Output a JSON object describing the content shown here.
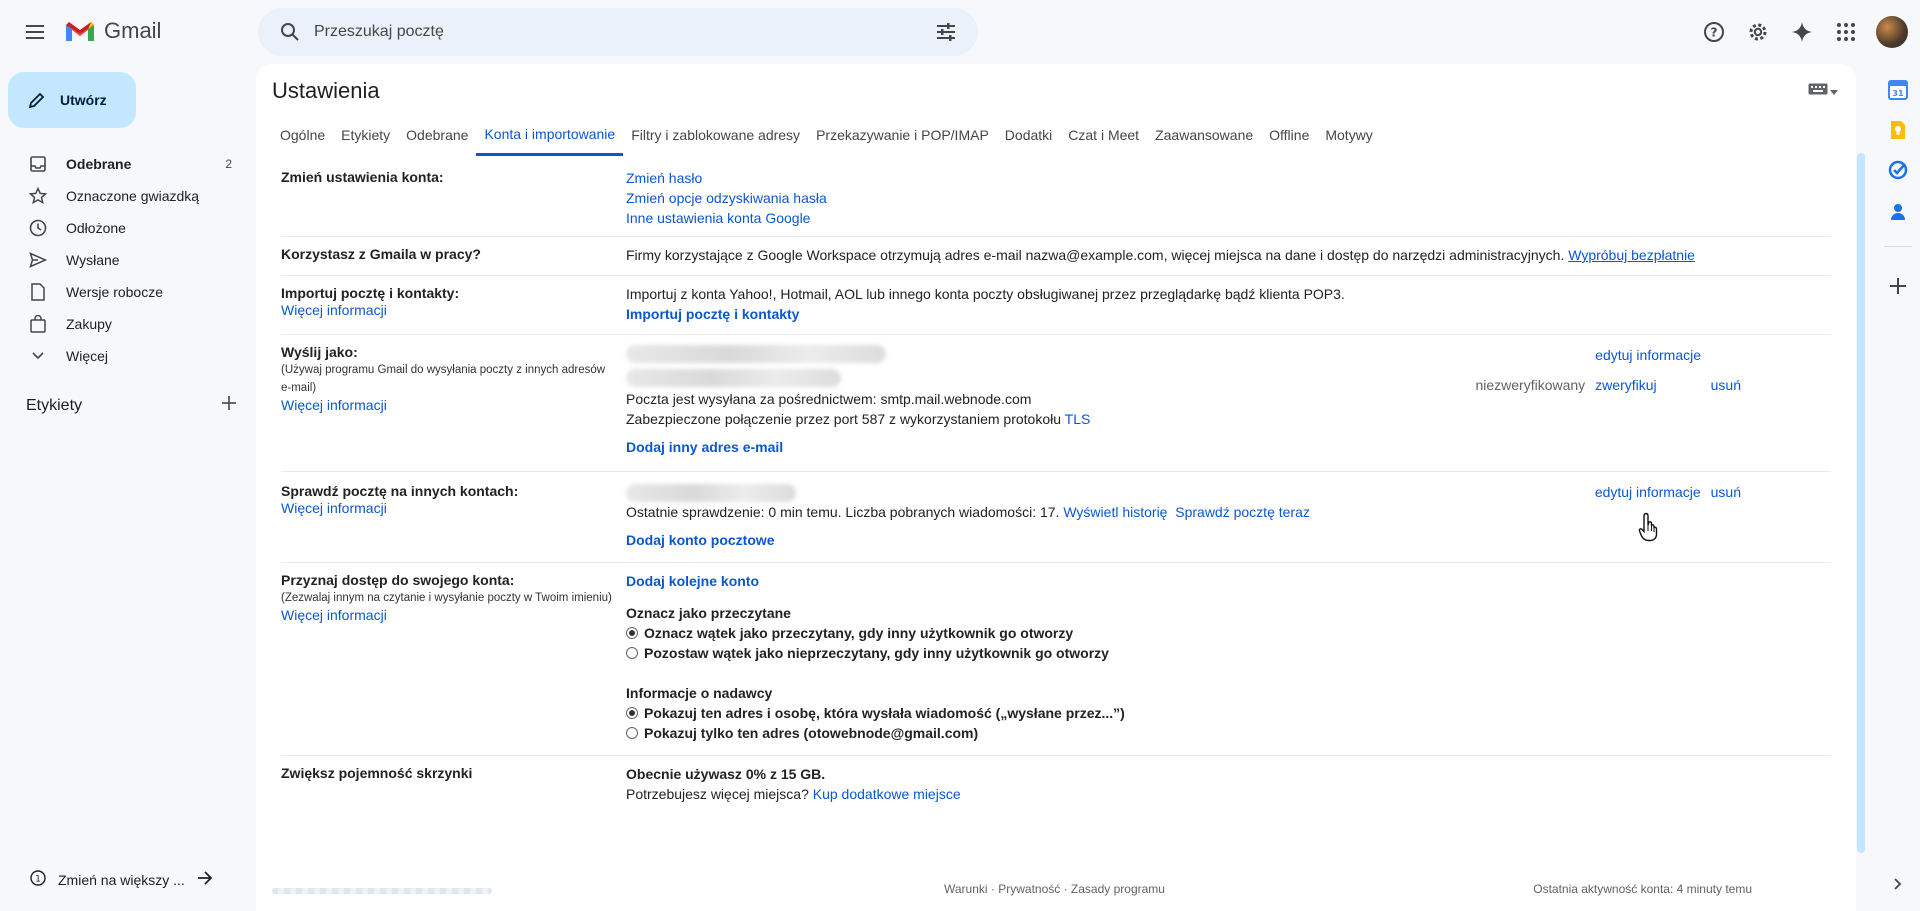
{
  "app": {
    "name": "Gmail"
  },
  "search": {
    "placeholder": "Przeszukaj pocztę"
  },
  "compose": {
    "label": "Utwórz"
  },
  "nav": [
    {
      "label": "Odebrane",
      "count": "2",
      "icon": "inbox-icon",
      "bold": true
    },
    {
      "label": "Oznaczone gwiazdką",
      "count": "",
      "icon": "star-icon",
      "bold": false
    },
    {
      "label": "Odłożone",
      "count": "",
      "icon": "clock-icon",
      "bold": false
    },
    {
      "label": "Wysłane",
      "count": "",
      "icon": "send-icon",
      "bold": false
    },
    {
      "label": "Wersje robocze",
      "count": "",
      "icon": "draft-icon",
      "bold": false
    },
    {
      "label": "Zakupy",
      "count": "",
      "icon": "shopping-bag-icon",
      "bold": false
    },
    {
      "label": "Więcej",
      "count": "",
      "icon": "chevron-down-icon",
      "bold": false
    }
  ],
  "labels_heading": "Etykiety",
  "bottom_left": "Zmień na większy ...",
  "page_title": "Ustawienia",
  "tabs": [
    {
      "label": "Ogólne",
      "active": false
    },
    {
      "label": "Etykiety",
      "active": false
    },
    {
      "label": "Odebrane",
      "active": false
    },
    {
      "label": "Konta i importowanie",
      "active": true
    },
    {
      "label": "Filtry i zablokowane adresy",
      "active": false
    },
    {
      "label": "Przekazywanie i POP/IMAP",
      "active": false
    },
    {
      "label": "Dodatki",
      "active": false
    },
    {
      "label": "Czat i Meet",
      "active": false
    },
    {
      "label": "Zaawansowane",
      "active": false
    },
    {
      "label": "Offline",
      "active": false
    },
    {
      "label": "Motywy",
      "active": false
    }
  ],
  "settings": {
    "change_account": {
      "title": "Zmień ustawienia konta:",
      "links": [
        "Zmień hasło",
        "Zmień opcje odzyskiwania hasła",
        "Inne ustawienia konta Google"
      ]
    },
    "work": {
      "title": "Korzystasz z Gmaila w pracy?",
      "text": "Firmy korzystające z Google Workspace otrzymują adres e-mail nazwa@example.com, więcej miejsca na dane i dostęp do narzędzi administracyjnych.",
      "link": "Wypróbuj bezpłatnie"
    },
    "import": {
      "title": "Importuj pocztę i kontakty:",
      "more": "Więcej informacji",
      "text": "Importuj z konta Yahoo!, Hotmail, AOL lub innego konta poczty obsługiwanej przez przeglądarkę bądź klienta POP3.",
      "link": "Importuj pocztę i kontakty"
    },
    "send_as": {
      "title": "Wyślij jako:",
      "sub": "(Używaj programu Gmail do wysyłania poczty z innych adresów e-mail)",
      "more": "Więcej informacji",
      "edit": "edytuj informacje",
      "unverified": "niezweryfikowany",
      "verify": "zweryfikuj",
      "remove": "usuń",
      "smtp": "Poczta jest wysyłana za pośrednictwem: smtp.mail.webnode.com",
      "secure_prefix": "Zabezpieczone połączenie przez port 587 z wykorzystaniem protokołu",
      "tls": "TLS",
      "add": "Dodaj inny adres e-mail"
    },
    "check_mail": {
      "title": "Sprawdź pocztę na innych kontach:",
      "more": "Więcej informacji",
      "edit": "edytuj informacje",
      "remove": "usuń",
      "status": "Ostatnie sprawdzenie: 0 min temu. Liczba pobranych wiadomości: 17.",
      "history": "Wyświetl historię",
      "check_now": "Sprawdź pocztę teraz",
      "add": "Dodaj konto pocztowe"
    },
    "grant": {
      "title": "Przyznaj dostęp do swojego konta:",
      "sub": "(Zezwalaj innym na czytanie i wysyłanie poczty w Twoim imieniu)",
      "more": "Więcej informacji",
      "add": "Dodaj kolejne konto",
      "mark_title": "Oznacz jako przeczytane",
      "mark_opt1": "Oznacz wątek jako przeczytany, gdy inny użytkownik go otworzy",
      "mark_opt2": "Pozostaw wątek jako nieprzeczytany, gdy inny użytkownik go otworzy",
      "sender_title": "Informacje o nadawcy",
      "sender_opt1": "Pokazuj ten adres i osobę, która wysłała wiadomość („wysłane przez...”)",
      "sender_opt2": "Pokazuj tylko ten adres (otowebnode@gmail.com)"
    },
    "storage": {
      "title": "Zwiększ pojemność skrzynki",
      "usage": "Obecnie używasz 0% z 15 GB.",
      "need": "Potrzebujesz więcej miejsca?",
      "buy": "Kup dodatkowe miejsce"
    }
  },
  "footer": {
    "terms": "Warunki · Prywatność · Zasady programu",
    "activity": "Ostatnia aktywność konta: 4 minuty temu"
  },
  "colors": {
    "accent": "#0b57d0",
    "compose_bg": "#c2e7ff",
    "background": "#f6f8fc"
  }
}
